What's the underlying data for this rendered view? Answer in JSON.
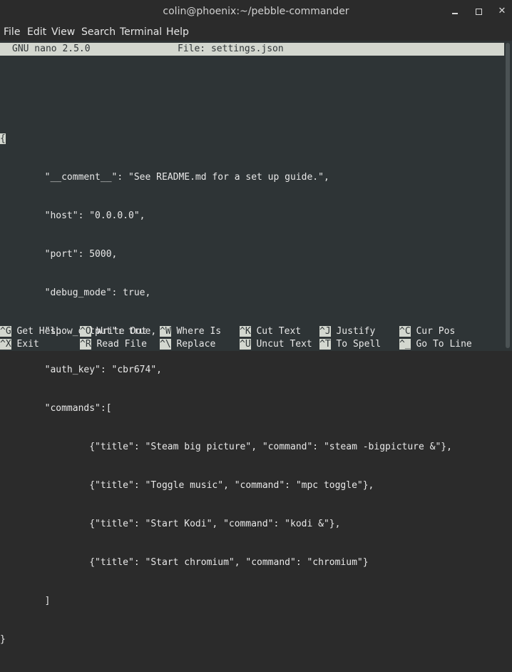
{
  "window": {
    "title": "colin@phoenix:~/pebble-commander",
    "controls": {
      "minimize": "minimize-icon",
      "maximize": "maximize-icon",
      "close": "close-icon"
    }
  },
  "menu": [
    "File",
    "Edit",
    "View",
    "Search",
    "Terminal",
    "Help"
  ],
  "nano": {
    "version": "GNU nano 2.5.0",
    "file_label": "File: settings.json"
  },
  "editor_lines": [
    "",
    "{",
    "        \"__comment__\": \"See README.md for a set up guide.\",",
    "        \"host\": \"0.0.0.0\",",
    "        \"port\": 5000,",
    "        \"debug_mode\": true,",
    "        \"show_output\": true,",
    "        \"auth_key\": \"cbr674\",",
    "        \"commands\":[",
    "                {\"title\": \"Steam big picture\", \"command\": \"steam -bigpicture &\"},",
    "                {\"title\": \"Toggle music\", \"command\": \"mpc toggle\"},",
    "                {\"title\": \"Start Kodi\", \"command\": \"kodi &\"},",
    "                {\"title\": \"Start chromium\", \"command\": \"chromium\"}",
    "        ]",
    "}"
  ],
  "shortcuts": [
    [
      {
        "key": "^G",
        "label": "Get Help"
      },
      {
        "key": "^O",
        "label": "Write Out"
      },
      {
        "key": "^W",
        "label": "Where Is"
      },
      {
        "key": "^K",
        "label": "Cut Text"
      },
      {
        "key": "^J",
        "label": "Justify"
      },
      {
        "key": "^C",
        "label": "Cur Pos"
      }
    ],
    [
      {
        "key": "^X",
        "label": "Exit"
      },
      {
        "key": "^R",
        "label": "Read File"
      },
      {
        "key": "^\\",
        "label": "Replace"
      },
      {
        "key": "^U",
        "label": "Uncut Text"
      },
      {
        "key": "^T",
        "label": "To Spell"
      },
      {
        "key": "^_",
        "label": "Go To Line"
      }
    ]
  ],
  "colors": {
    "terminal_bg": "#2e3436",
    "terminal_fg": "#e8e8e8",
    "inverse_bg": "#d3d7cf",
    "titlebar_bg": "#2b2b2b"
  }
}
